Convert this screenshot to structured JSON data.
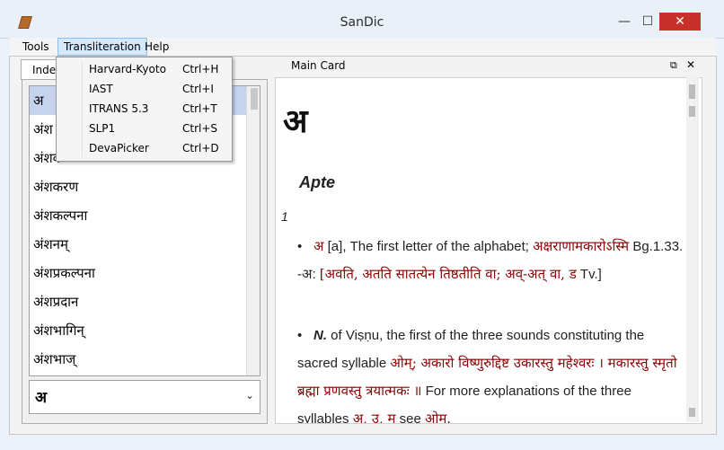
{
  "window": {
    "title": "SanDic",
    "minimize": "—",
    "maximize": "☐",
    "close": "✕"
  },
  "menubar": {
    "tools": "Tools",
    "transliteration": "Transliteration",
    "help": "Help"
  },
  "transliteration_menu": [
    {
      "label": "Harvard-Kyoto",
      "shortcut": "Ctrl+H"
    },
    {
      "label": "IAST",
      "shortcut": "Ctrl+I"
    },
    {
      "label": "ITRANS 5.3",
      "shortcut": "Ctrl+T"
    },
    {
      "label": "SLP1",
      "shortcut": "Ctrl+S"
    },
    {
      "label": "DevaPicker",
      "shortcut": "Ctrl+D"
    }
  ],
  "left_panel": {
    "tab_label": "Index",
    "index_items": [
      "अ",
      "अंश",
      "अंशक",
      "अंशकरण",
      "अंशकल्पना",
      "अंशनम्",
      "अंशप्रकल्पना",
      "अंशप्रदान",
      "अंशभागिन्",
      "अंशभाज्"
    ],
    "dropdown_value": "अ",
    "dropdown_chevron": "⌄"
  },
  "card": {
    "header_title": "Main Card",
    "restore_icon": "⧉",
    "close_icon": "✕",
    "headword": "अ",
    "dictionary": "Apte",
    "sense_number": "1",
    "entry": {
      "p1_bullet": "•",
      "p1_skt1": "अ",
      "p1_text1": " [a], The first letter of the alphabet; ",
      "p1_skt2": "अक्षराणामकारोऽस्मि",
      "p1_text2": " Bg.1.33. -अ: ",
      "p1_skt3": "[अवति, अतति सातत्येन तिष्ठतीति वा; अव्-अत् वा, ड",
      "p1_text3": " Tv.]",
      "p2_bullet": "•",
      "p2_n": "N.",
      "p2_text1": " of Viṣṇu, the first of the three sounds constituting the sacred syllable ",
      "p2_skt1": "ओम्; अकारो विष्णुरुद्दिष्ट उकारस्तु महेश्वरः । मकारस्तु स्मृतो ब्रह्मा प्रणवस्तु त्रयात्मकः ॥",
      "p2_text2": " For more explanations of the three syllables ",
      "p2_skt2": "अ, उ, म",
      "p2_text3": " see ",
      "p2_skt3": "ओम्."
    }
  }
}
